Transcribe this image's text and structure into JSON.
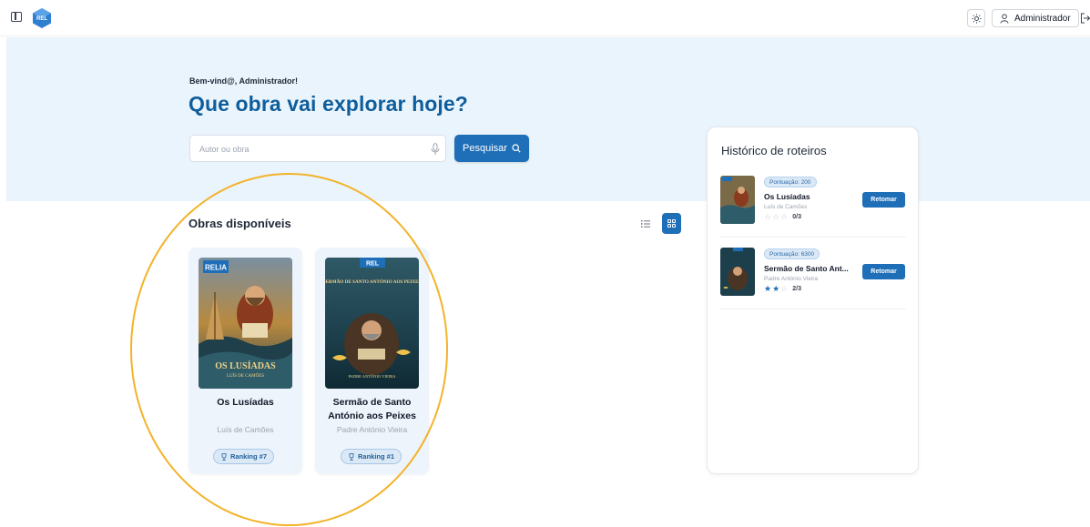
{
  "header": {
    "user_label": "Administrador",
    "logo_text": "REL"
  },
  "hero": {
    "welcome": "Bem-vind@, Administrador!",
    "headline": "Que obra vai explorar hoje?",
    "search_placeholder": "Autor ou obra",
    "search_button": "Pesquisar"
  },
  "catalog": {
    "title": "Obras disponíveis",
    "view_mode": "grid",
    "books": [
      {
        "title": "Os Lusíadas",
        "author": "Luís de Camões",
        "ranking": "Ranking #7",
        "cover_brand": "RELIA",
        "cover_title": "OS LUSÍADAS",
        "cover_subtitle": "LUÍS DE CAMÕES"
      },
      {
        "title": "Sermão de Santo António aos Peixes",
        "author": "Padre António Vieira",
        "ranking": "Ranking #1",
        "cover_brand": "REL",
        "cover_title": "SERMÃO DE SANTO ANTÓNIO AOS PEIXES",
        "cover_subtitle": "PADRE ANTÓNIO VIEIRA"
      }
    ]
  },
  "history": {
    "title": "Histórico de roteiros",
    "items": [
      {
        "score": "Pontuação: 200",
        "title": "Os Lusíadas",
        "author": "Luís de Camões",
        "stars_filled": 0,
        "stars_total": 3,
        "progress": "0/3",
        "button": "Retomar"
      },
      {
        "score": "Pontuação: 6300",
        "title": "Sermão de Santo Ant...",
        "author": "Padre António Vieira",
        "stars_filled": 2,
        "stars_total": 3,
        "progress": "2/3",
        "button": "Retomar"
      }
    ]
  },
  "colors": {
    "accent": "#1f6fb8",
    "headline": "#0f5e9c",
    "hero_bg": "#eaf4fc",
    "highlight": "#f3b32a"
  }
}
